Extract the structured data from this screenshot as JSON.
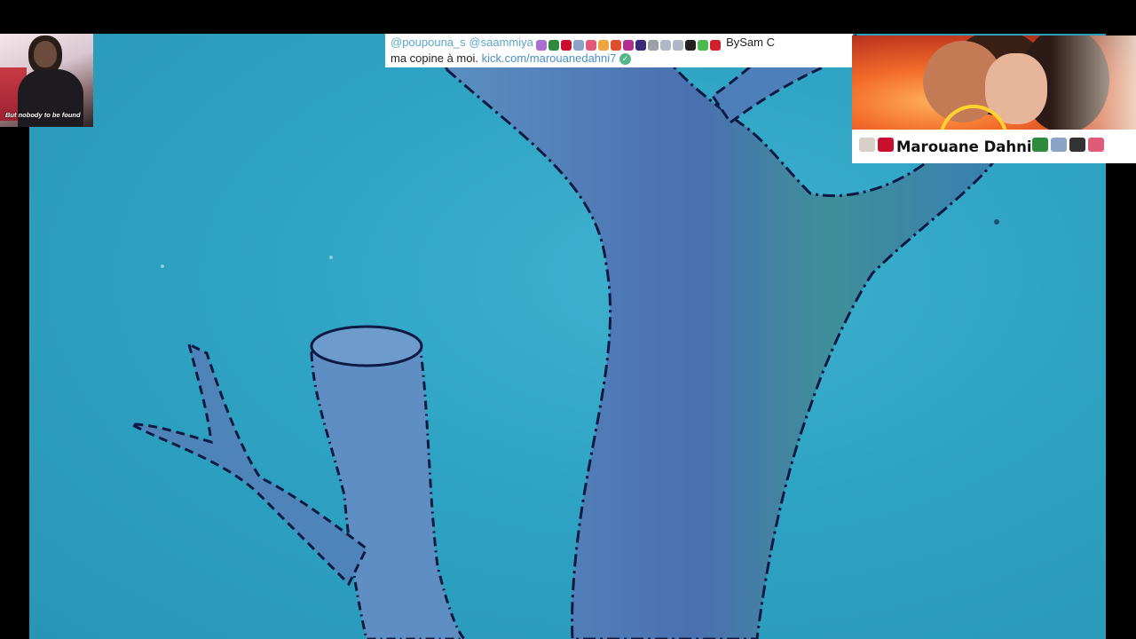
{
  "thumbnail": {
    "caption": "But nobody to be found"
  },
  "comment": {
    "mention1": "@poupouna_s",
    "mention2": "@saammiya",
    "by_text": "BySam C",
    "line2_text": "ma copine à moi.",
    "link": "kick.com/marouanedahni7",
    "emoji_colors": [
      "#a86fd0",
      "#2e8b3e",
      "#c8102e",
      "#8ca3c8",
      "#e05a7a",
      "#f0a640",
      "#e05030",
      "#b03090",
      "#3a2a7a",
      "#9aa0a8",
      "#b0b8c8",
      "#b0b8c8",
      "#222222",
      "#4cbb4c",
      "#d0202e"
    ],
    "verified_icon": "check-circle-icon",
    "colors": {
      "mention": "#5ea6c8",
      "link": "#4a8fc6"
    }
  },
  "streamer": {
    "name": "Marouane Dahni",
    "prefix_emojis": [
      "#d8d0c8",
      "#c8102e"
    ],
    "suffix_emojis": [
      "#2e8b3e",
      "#8ca3c8",
      "#333333",
      "#e05a7a"
    ]
  },
  "background": {
    "description_colors": {
      "sky": "#2fa3c3",
      "tree": "#3f6da6"
    }
  }
}
